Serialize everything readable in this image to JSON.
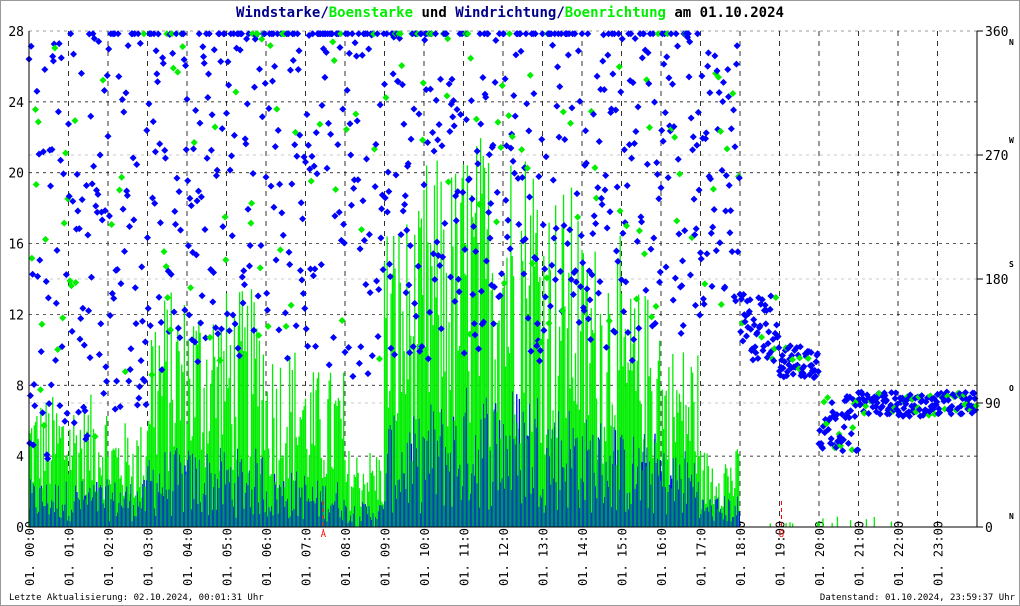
{
  "title": {
    "part1": "Windstarke/",
    "part2": "Boenstarke",
    "part3": " und ",
    "part4": "Windrichtung/",
    "part5": "Boenrichtung",
    "part6": " am 01.10.2024"
  },
  "footer": {
    "left": "Letzte Aktualisierung: 02.10.2024, 00:01:31 Uhr",
    "right": "Datenstand: 01.10.2024, 23:59:37 Uhr"
  },
  "chart_data": {
    "type": "bar+scatter",
    "title": "Windstarke/Boenstarke und Windrichtung/Boenrichtung am 01.10.2024",
    "xlabel": "",
    "ylabel": "",
    "y2label": "",
    "ylim": [
      0,
      28
    ],
    "y2lim": [
      0,
      360
    ],
    "yticks": [
      "0",
      "4",
      "8",
      "12",
      "16",
      "20",
      "24",
      "28"
    ],
    "y2ticks": [
      {
        "v": 0,
        "label": "0",
        "dir": "N"
      },
      {
        "v": 90,
        "label": "90",
        "dir": "O"
      },
      {
        "v": 180,
        "label": "180",
        "dir": "S"
      },
      {
        "v": 270,
        "label": "270",
        "dir": "W"
      },
      {
        "v": 360,
        "label": "360",
        "dir": "N"
      }
    ],
    "xticks": [
      "01. 00:00",
      "01. 01:00",
      "01. 02:00",
      "01. 03:00",
      "01. 04:00",
      "01. 05:00",
      "01. 06:00",
      "01. 07:00",
      "01. 08:00",
      "01. 09:00",
      "01. 10:00",
      "01. 11:00",
      "01. 12:00",
      "01. 13:00",
      "01. 14:00",
      "01. 15:00",
      "01. 16:00",
      "01. 17:00",
      "01. 18:00",
      "01. 19:00",
      "01. 20:00",
      "01. 21:00",
      "01. 22:00",
      "01. 23:00"
    ],
    "markers": [
      {
        "hour": 7.45,
        "label": "A"
      },
      {
        "hour": 19.05,
        "label": "U"
      }
    ],
    "colors": {
      "wind": "#0000ff",
      "gust": "#00ee00",
      "marker": "#ff0000",
      "grid": "#000000"
    },
    "series": [
      {
        "name": "Windstarke (hourly mean)",
        "values": [
          1.5,
          1.5,
          1.5,
          2.5,
          2.5,
          2.5,
          1.8,
          1.5,
          0.8,
          3.5,
          4,
          4.5,
          4.5,
          4,
          3.5,
          3,
          2.5,
          1,
          0,
          0,
          0,
          0,
          0,
          0
        ]
      },
      {
        "name": "Boenstarke (hourly mean)",
        "values": [
          5,
          5,
          4,
          9,
          9,
          9,
          7,
          6,
          3,
          12,
          14,
          15,
          15,
          13,
          11,
          9,
          7,
          3,
          0.5,
          0.2,
          0.5,
          0.5,
          0,
          0
        ]
      },
      {
        "name": "Windrichtung (hourly center, deg)",
        "values": [
          200,
          220,
          240,
          260,
          270,
          270,
          270,
          260,
          250,
          270,
          270,
          270,
          270,
          280,
          270,
          270,
          270,
          250,
          145,
          120,
          75,
          90,
          88,
          90
        ]
      },
      {
        "name": "Windrichtung spread (deg)",
        "values": [
          160,
          160,
          160,
          150,
          150,
          150,
          150,
          150,
          150,
          150,
          150,
          150,
          150,
          150,
          150,
          150,
          130,
          100,
          25,
          12,
          20,
          8,
          8,
          8
        ]
      }
    ]
  }
}
